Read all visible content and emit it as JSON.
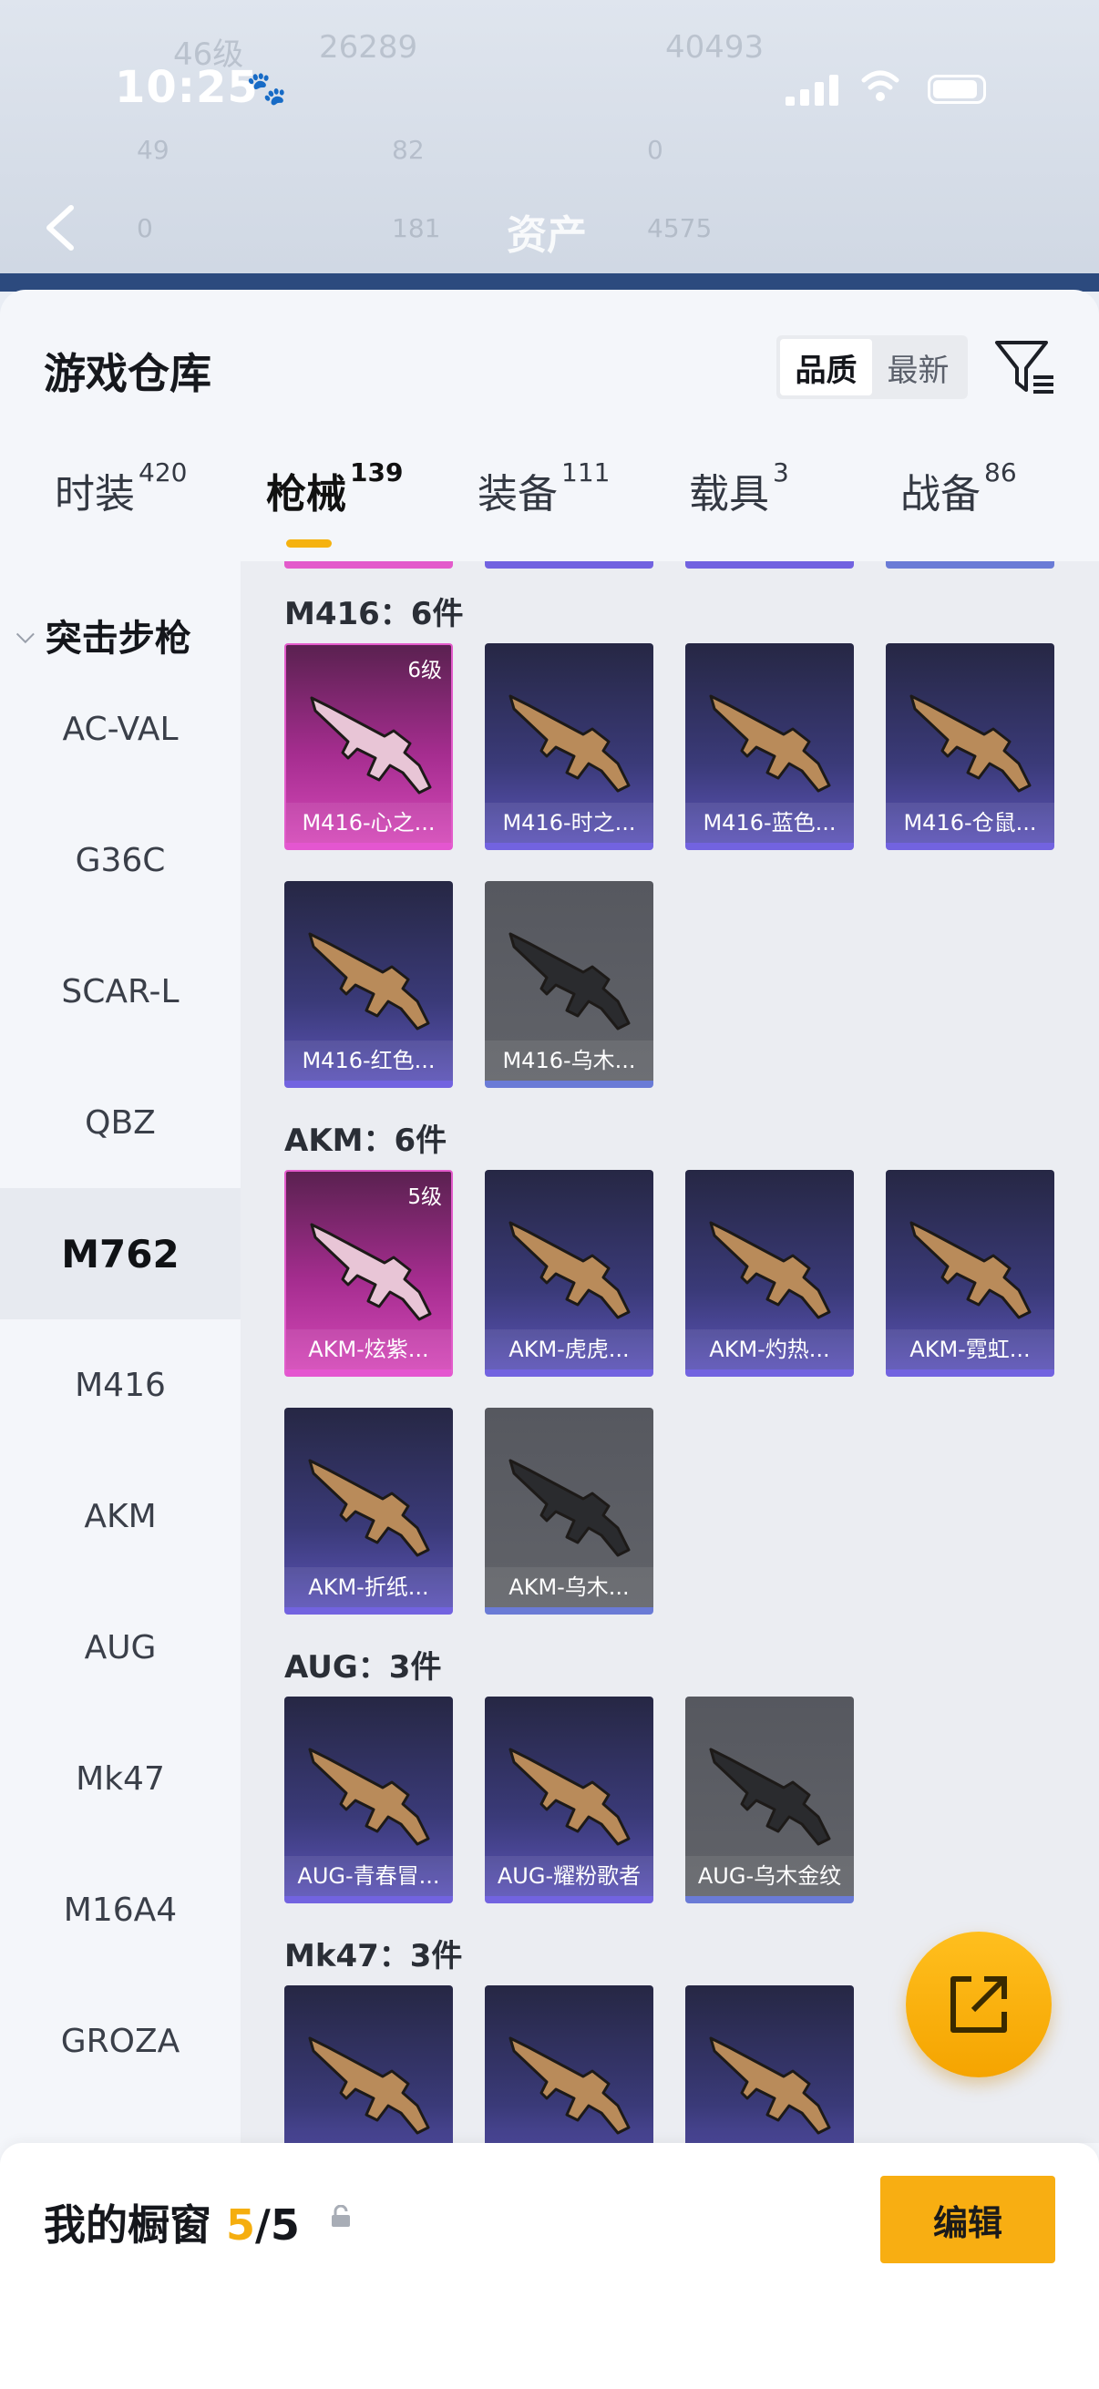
{
  "background": {
    "faint_items": [
      "46级",
      "26289",
      "40493",
      "49",
      "82",
      "0",
      "0",
      "181",
      "4575"
    ]
  },
  "status_bar": {
    "time": "10:25"
  },
  "nav": {
    "title": "资产"
  },
  "sheet": {
    "title": "游戏仓库",
    "sort": {
      "quality_label": "品质",
      "newest_label": "最新",
      "selected": "品质"
    }
  },
  "tabs": [
    {
      "label": "时装",
      "count": "420"
    },
    {
      "label": "枪械",
      "count": "139",
      "active": true
    },
    {
      "label": "装备",
      "count": "111"
    },
    {
      "label": "载具",
      "count": "3"
    },
    {
      "label": "战备",
      "count": "86"
    }
  ],
  "sidebar": {
    "category": "突击步枪",
    "items": [
      "AC-VAL",
      "G36C",
      "SCAR-L",
      "QBZ",
      "M762",
      "M416",
      "AKM",
      "AUG",
      "Mk47",
      "M16A4",
      "GROZA"
    ],
    "selected": "M762"
  },
  "groups": [
    {
      "title": "M416：6件",
      "items": [
        {
          "name": "M416-心之...",
          "level": "6级",
          "rarity": "pink"
        },
        {
          "name": "M416-时之...",
          "rarity": "purple"
        },
        {
          "name": "M416-蓝色...",
          "rarity": "purple"
        },
        {
          "name": "M416-仓鼠...",
          "rarity": "purple"
        },
        {
          "name": "M416-红色...",
          "rarity": "purple"
        },
        {
          "name": "M416-乌木...",
          "rarity": "grey"
        }
      ]
    },
    {
      "title": "AKM：6件",
      "items": [
        {
          "name": "AKM-炫紫...",
          "level": "5级",
          "rarity": "pink"
        },
        {
          "name": "AKM-虎虎...",
          "rarity": "purple"
        },
        {
          "name": "AKM-灼热...",
          "rarity": "purple"
        },
        {
          "name": "AKM-霓虹...",
          "rarity": "purple"
        },
        {
          "name": "AKM-折纸...",
          "rarity": "purple"
        },
        {
          "name": "AKM-乌木...",
          "rarity": "grey"
        }
      ]
    },
    {
      "title": "AUG：3件",
      "items": [
        {
          "name": "AUG-青春冒...",
          "rarity": "purple"
        },
        {
          "name": "AUG-耀粉歌者",
          "rarity": "purple"
        },
        {
          "name": "AUG-乌木金纹",
          "rarity": "grey"
        }
      ]
    },
    {
      "title": "Mk47：3件",
      "items": [
        {
          "name": "",
          "rarity": "purple"
        },
        {
          "name": "",
          "rarity": "purple"
        },
        {
          "name": "",
          "rarity": "purple"
        }
      ]
    }
  ],
  "bottom": {
    "title": "我的橱窗",
    "count": "5",
    "total": "5",
    "edit_label": "编辑"
  },
  "colors": {
    "accent": "#f5ae0f",
    "pink_rarity": "#d448b8",
    "purple_rarity": "#5b53b6",
    "grey_rarity": "#616369"
  }
}
